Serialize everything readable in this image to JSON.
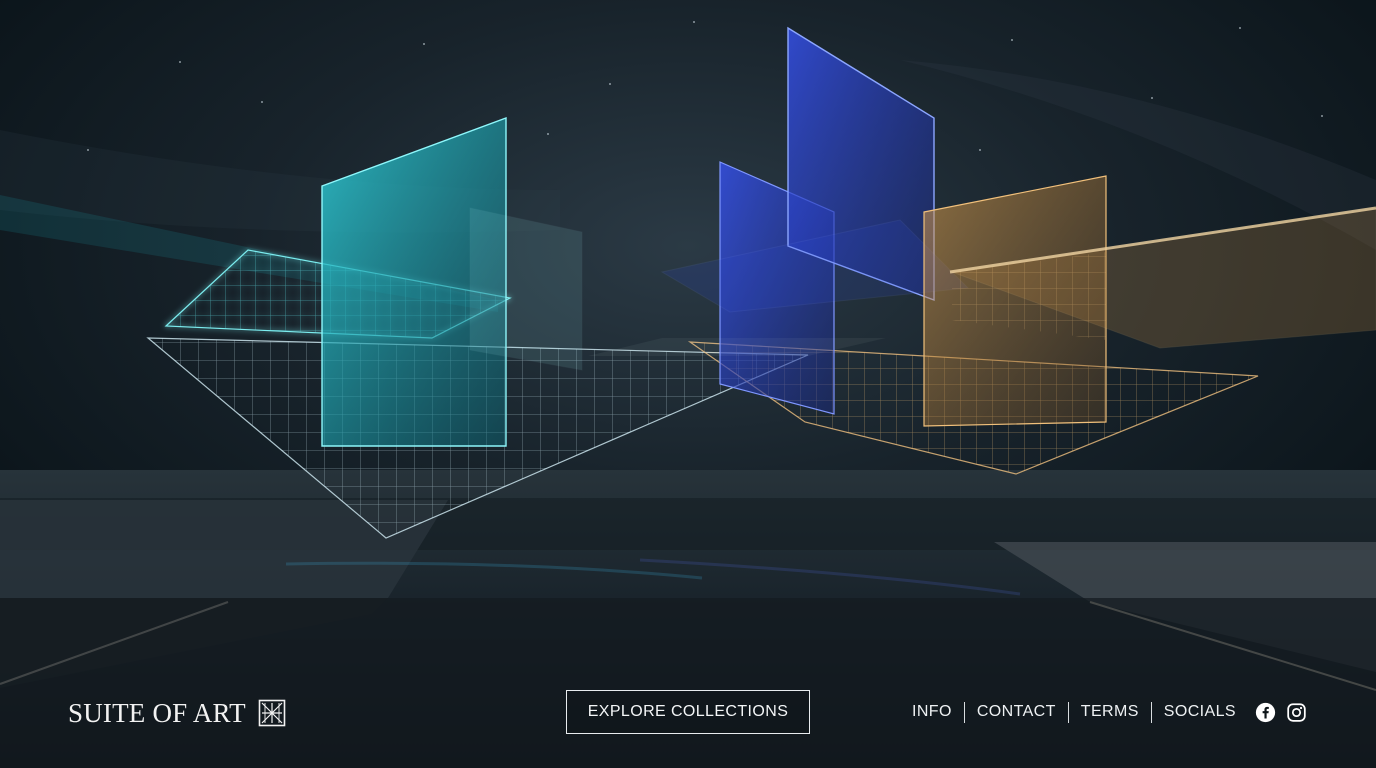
{
  "brand": {
    "name": "SUITE OF ART",
    "logo_icon": "geometric-square-mark-icon"
  },
  "cta": {
    "label": "EXPLORE COLLECTIONS"
  },
  "nav": {
    "items": [
      {
        "label": "INFO"
      },
      {
        "label": "CONTACT"
      },
      {
        "label": "TERMS"
      },
      {
        "label": "SOCIALS"
      }
    ]
  },
  "socials": {
    "facebook_icon": "facebook-icon",
    "instagram_icon": "instagram-icon"
  },
  "theme": {
    "background": "#0d1418",
    "teal_glass": "#2fd0da",
    "blue_glass": "#3550e8",
    "amber_glass": "#e3a24a",
    "text": "#f2f2f2"
  }
}
